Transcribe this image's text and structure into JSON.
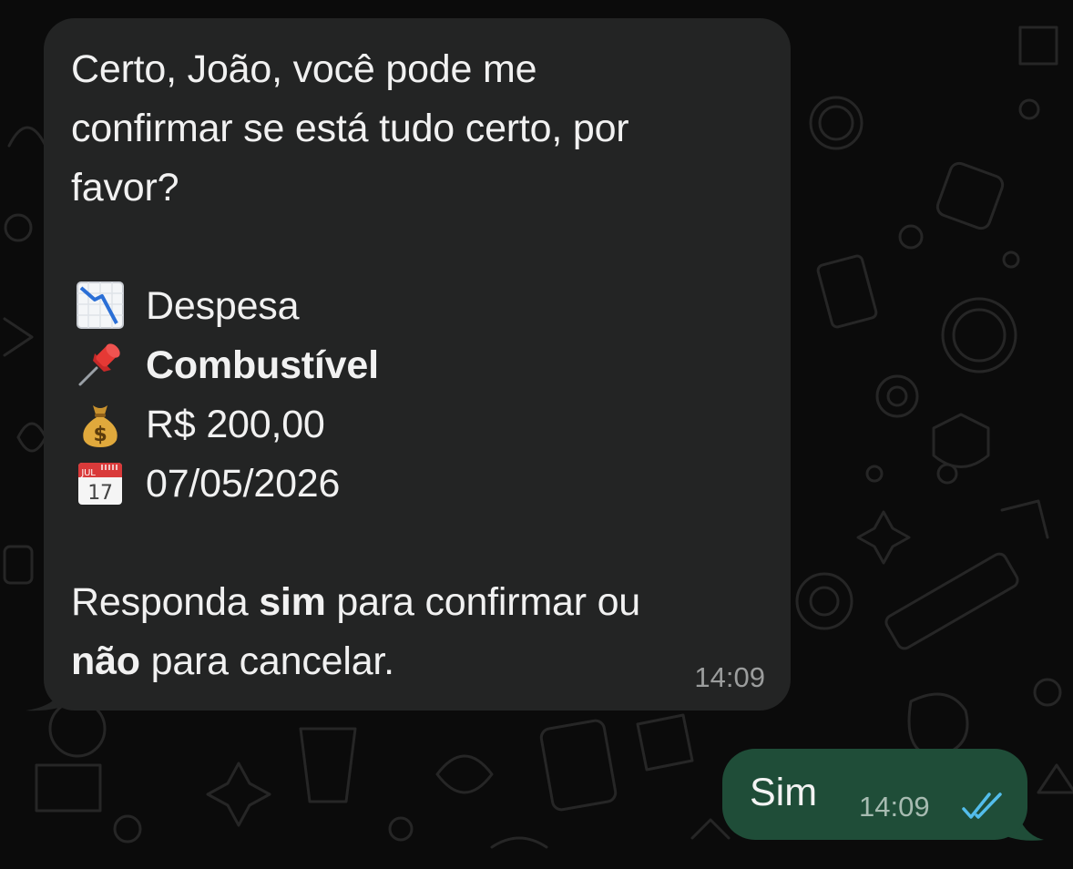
{
  "colors": {
    "background": "#0b0b0b",
    "incoming_bubble": "#232424",
    "outgoing_bubble": "#1f4d38",
    "read_receipt": "#53bdeb"
  },
  "incoming_message": {
    "line1": "Certo, João, você pode me",
    "line2": "confirmar se está tudo certo, por",
    "line3": "favor?",
    "items": [
      {
        "icon": "chart-decreasing-icon",
        "text": "Despesa"
      },
      {
        "icon": "pushpin-icon",
        "text": "Combustível"
      },
      {
        "icon": "money-bag-icon",
        "text": "R$ 200,00"
      },
      {
        "icon": "calendar-icon",
        "text": "07/05/2026"
      }
    ],
    "calendar_month": "JUL",
    "calendar_day": "17",
    "reply_prefix": "Responda ",
    "reply_yes": "sim",
    "reply_mid": " para confirmar ou",
    "reply_no": "não",
    "reply_suffix": " para cancelar.",
    "time": "14:09"
  },
  "outgoing_message": {
    "text": "Sim",
    "time": "14:09",
    "status_icon": "double-check-read-icon"
  }
}
